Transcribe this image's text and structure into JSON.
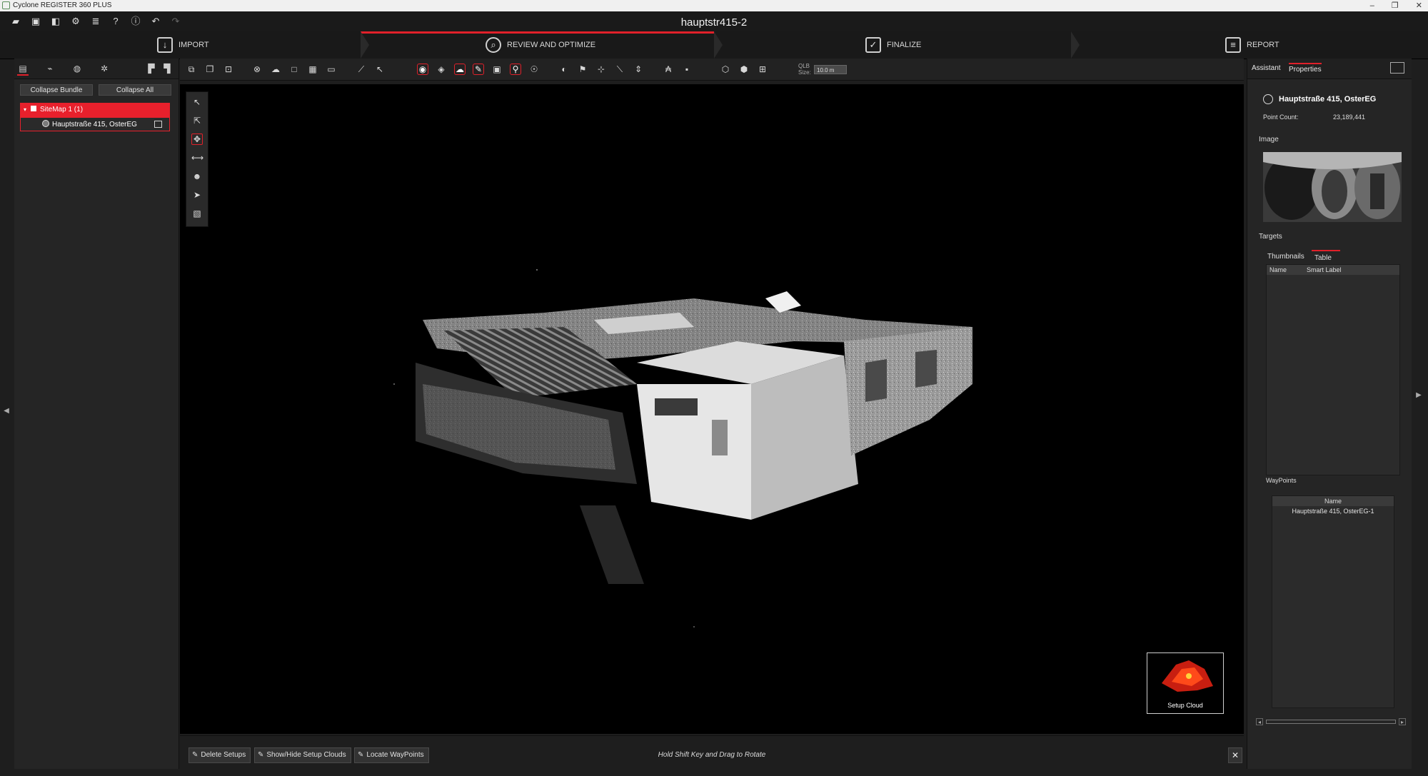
{
  "window": {
    "app_title": "Cyclone REGISTER 360 PLUS",
    "minimize": "–",
    "restore": "❐",
    "close": "✕"
  },
  "project": {
    "title": "hauptstr415-2"
  },
  "workflow": {
    "steps": [
      {
        "label": "IMPORT",
        "icon": "import-icon"
      },
      {
        "label": "REVIEW AND OPTIMIZE",
        "icon": "review-icon"
      },
      {
        "label": "FINALIZE",
        "icon": "finalize-icon"
      },
      {
        "label": "REPORT",
        "icon": "report-icon"
      }
    ],
    "active": "REVIEW AND OPTIMIZE"
  },
  "left_panel": {
    "collapse_bundle": "Collapse Bundle",
    "collapse_all": "Collapse All",
    "tree": [
      {
        "label": "SiteMap 1 (1)",
        "selected": true
      },
      {
        "label": "Hauptstraße 415, OsterEG",
        "selected": false
      }
    ]
  },
  "toolbar": {
    "qlb": "QLB",
    "size_label": "Size:",
    "size_value": "10.0 m"
  },
  "viewport": {
    "setup_cloud_label": "Setup Cloud"
  },
  "right_panel": {
    "tabs": [
      "Assistant",
      "Properties"
    ],
    "active_tab": "Properties",
    "setup_name": "Hauptstraße 415, OsterEG",
    "point_count_label": "Point Count:",
    "point_count_value": "23,189,441",
    "image_label": "Image",
    "targets_label": "Targets",
    "targets_tabs": [
      "Thumbnails",
      "Table"
    ],
    "targets_active_tab": "Table",
    "targets_columns": [
      "Name",
      "Smart Label"
    ],
    "waypoints_label": "WayPoints",
    "waypoints_column": "Name",
    "waypoints_rows": [
      "Hauptstraße 415, OsterEG-1"
    ]
  },
  "bottom_bar": {
    "delete_setups": "Delete Setups",
    "show_hide_setup_clouds": "Show/Hide Setup Clouds",
    "locate_waypoints": "Locate WayPoints",
    "hint": "Hold Shift Key and Drag to Rotate",
    "close": "✕"
  },
  "colors": {
    "accent": "#e0202a",
    "background": "#1e1e1e",
    "viewport": "#000000"
  }
}
